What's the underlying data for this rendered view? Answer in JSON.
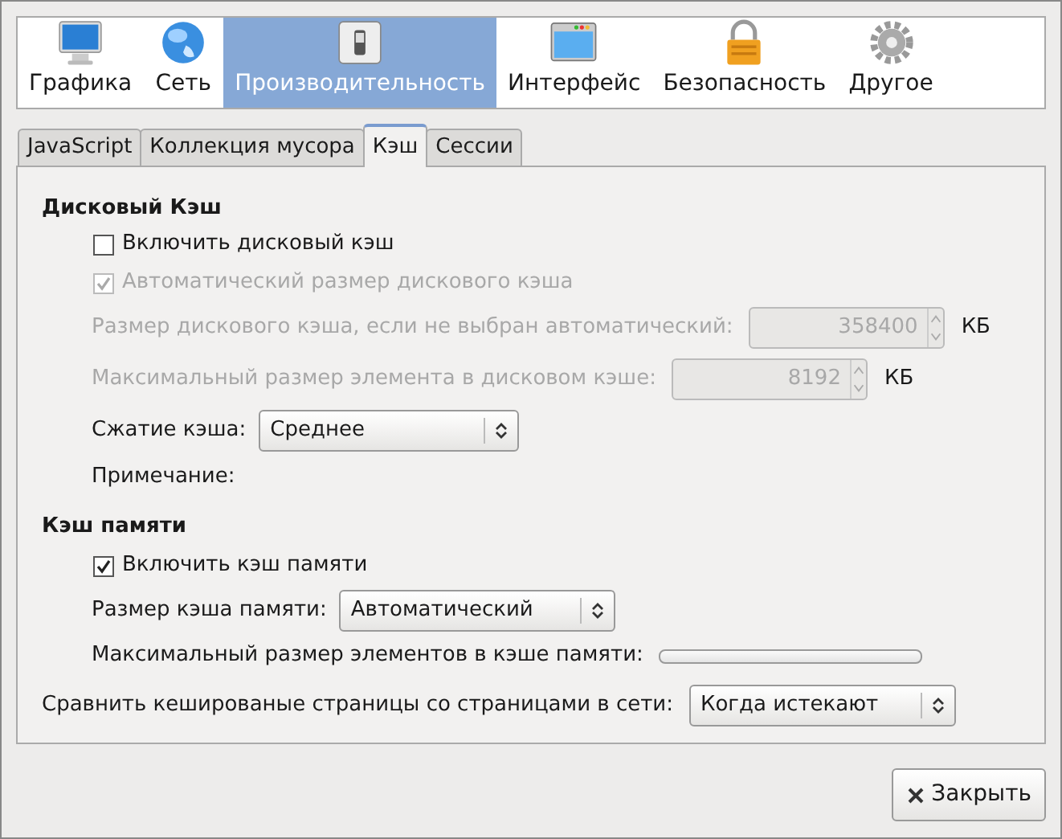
{
  "categories": [
    {
      "label": "Графика",
      "selected": false
    },
    {
      "label": "Сеть",
      "selected": false
    },
    {
      "label": "Производительность",
      "selected": true
    },
    {
      "label": "Интерфейс",
      "selected": false
    },
    {
      "label": "Безопасность",
      "selected": false
    },
    {
      "label": "Другое",
      "selected": false
    }
  ],
  "tabs": [
    {
      "label": "JavaScript",
      "selected": false
    },
    {
      "label": "Коллекция мусора",
      "selected": false
    },
    {
      "label": "Кэш",
      "selected": true
    },
    {
      "label": "Сессии",
      "selected": false
    }
  ],
  "disk_cache": {
    "title": "Дисковый Кэш",
    "rows": [
      {
        "kind": "checkbox",
        "label": "Включить дисковый кэш",
        "checked": false,
        "disabled": false
      },
      {
        "kind": "checkbox",
        "label": "Автоматический размер дискового кэша",
        "checked": true,
        "disabled": true
      },
      {
        "kind": "number",
        "label": "Размер дискового кэша, если не выбран автоматический:",
        "value": "358400",
        "unit": "КБ",
        "disabled": true
      },
      {
        "kind": "number",
        "label": "Максимальный размер элемента в дисковом кэше:",
        "value": "8192",
        "unit": "КБ",
        "disabled": true
      },
      {
        "kind": "select",
        "label": "Сжатие кэша:",
        "value": "Среднее"
      },
      {
        "kind": "note",
        "label": "Примечание:"
      }
    ]
  },
  "memory_cache": {
    "title": "Кэш памяти",
    "rows": [
      {
        "kind": "checkbox",
        "label": "Включить кэш памяти",
        "checked": true,
        "disabled": false
      },
      {
        "kind": "select",
        "label": "Размер кэша памяти:",
        "value": "Автоматический"
      },
      {
        "kind": "slider",
        "label": "Максимальный размер элементов в кэше памяти:"
      }
    ]
  },
  "compare": {
    "label": "Сравнить кешированые страницы со страницами в сети:",
    "value": "Когда истекают"
  },
  "close_button": {
    "label": "Закрыть"
  }
}
